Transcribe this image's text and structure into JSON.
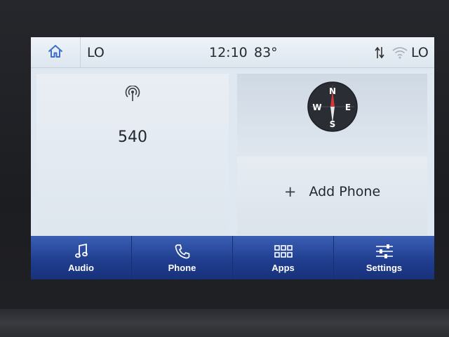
{
  "status_bar": {
    "home_icon": "home-icon",
    "climate_left": "LO",
    "clock": "12:10",
    "temperature": "83°",
    "climate_right": "LO",
    "signal_icon": "data-transfer-icon",
    "wifi_icon": "wifi-icon"
  },
  "tiles": {
    "radio": {
      "icon": "broadcast-icon",
      "frequency": "540"
    },
    "compass": {
      "icon": "compass-icon",
      "letters": {
        "n": "N",
        "s": "S",
        "e": "E",
        "w": "W"
      }
    },
    "phone": {
      "icon": "plus-icon",
      "plus": "+",
      "label": "Add Phone"
    }
  },
  "nav": {
    "items": [
      {
        "label": "Audio",
        "icon": "music-note-icon"
      },
      {
        "label": "Phone",
        "icon": "phone-icon"
      },
      {
        "label": "Apps",
        "icon": "apps-grid-icon"
      },
      {
        "label": "Settings",
        "icon": "sliders-icon"
      }
    ]
  },
  "colors": {
    "accent_blue": "#2a4a9e",
    "screen_bg": "#dfe7f0",
    "text": "#24282e",
    "icon_blue": "#3d6fc8"
  }
}
